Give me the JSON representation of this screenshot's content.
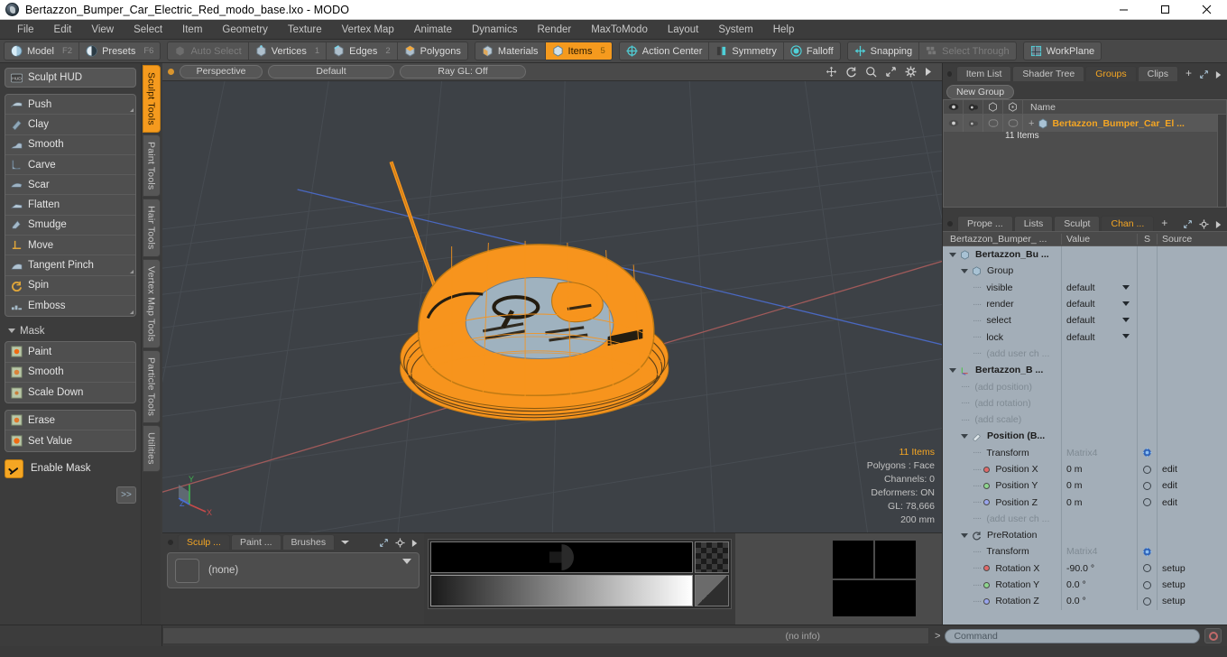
{
  "window": {
    "title": "Bertazzon_Bumper_Car_Electric_Red_modo_base.lxo - MODO",
    "app_icon": "modo-logo-icon",
    "controls": [
      {
        "name": "minimize-button",
        "glyph": "minimize-icon"
      },
      {
        "name": "maximize-button",
        "glyph": "maximize-icon"
      },
      {
        "name": "close-button",
        "glyph": "close-icon"
      }
    ]
  },
  "menubar": {
    "items": [
      "File",
      "Edit",
      "View",
      "Select",
      "Item",
      "Geometry",
      "Texture",
      "Vertex Map",
      "Animate",
      "Dynamics",
      "Render",
      "MaxToModo",
      "Layout",
      "System",
      "Help"
    ]
  },
  "toolbar": {
    "groups": [
      {
        "name": "mode-group",
        "buttons": [
          {
            "label": "Model",
            "key": "F2",
            "icon": "sphere-icon",
            "active": false,
            "dim": false
          },
          {
            "label": "Presets",
            "key": "F6",
            "icon": "half-sphere-icon",
            "active": false,
            "dim": false
          }
        ]
      },
      {
        "name": "selection-mode-group",
        "buttons": [
          {
            "label": "Auto Select",
            "key": "",
            "icon": "cube-gray-icon",
            "active": false,
            "dim": true
          },
          {
            "label": "Vertices",
            "key": "1",
            "icon": "cube-vertex-icon",
            "active": false,
            "dim": false
          },
          {
            "label": "Edges",
            "key": "2",
            "icon": "cube-edge-icon",
            "active": false,
            "dim": false
          },
          {
            "label": "Polygons",
            "key": "",
            "icon": "cube-polygon-icon",
            "active": false,
            "dim": false
          }
        ]
      },
      {
        "name": "item-mode-group",
        "buttons": [
          {
            "label": "Materials",
            "key": "",
            "icon": "cube-material-icon",
            "active": false,
            "dim": false
          },
          {
            "label": "Items",
            "key": "5",
            "icon": "cube-items-icon",
            "active": true,
            "dim": false
          }
        ]
      },
      {
        "name": "action-group",
        "buttons": [
          {
            "label": "Action Center",
            "key": "",
            "icon": "crosshair-circle-icon",
            "active": false,
            "dim": false
          },
          {
            "label": "Symmetry",
            "key": "",
            "icon": "symmetry-icon",
            "active": false,
            "dim": false
          },
          {
            "label": "Falloff",
            "key": "",
            "icon": "falloff-circle-icon",
            "active": false,
            "dim": false
          }
        ]
      },
      {
        "name": "snapping-group",
        "buttons": [
          {
            "label": "Snapping",
            "key": "",
            "icon": "snap-cross-icon",
            "active": false,
            "dim": false
          },
          {
            "label": "Select Through",
            "key": "",
            "icon": "select-through-icon",
            "active": false,
            "dim": true
          }
        ]
      },
      {
        "name": "workplane-group",
        "buttons": [
          {
            "label": "WorkPlane",
            "key": "",
            "icon": "workplane-grid-icon",
            "active": false,
            "dim": false
          }
        ]
      }
    ]
  },
  "left_panel": {
    "hud": {
      "label": "Sculpt HUD",
      "icon": "hud-icon"
    },
    "tools": [
      {
        "label": "Push",
        "icon": "push-brush-icon",
        "corner": true
      },
      {
        "label": "Clay",
        "icon": "clay-brush-icon",
        "corner": false
      },
      {
        "label": "Smooth",
        "icon": "smooth-brush-icon",
        "corner": false
      },
      {
        "label": "Carve",
        "icon": "carve-brush-icon",
        "corner": false
      },
      {
        "label": "Scar",
        "icon": "scar-brush-icon",
        "corner": false
      },
      {
        "label": "Flatten",
        "icon": "flatten-brush-icon",
        "corner": false
      },
      {
        "label": "Smudge",
        "icon": "smudge-brush-icon",
        "corner": false
      },
      {
        "label": "Move",
        "icon": "move-brush-icon",
        "corner": false
      },
      {
        "label": "Tangent Pinch",
        "icon": "pinch-brush-icon",
        "corner": true
      },
      {
        "label": "Spin",
        "icon": "spin-brush-icon",
        "corner": false
      },
      {
        "label": "Emboss",
        "icon": "emboss-brush-icon",
        "corner": true
      }
    ],
    "mask_section": {
      "header": "Mask",
      "tools": [
        {
          "label": "Paint",
          "icon": "mask-paint-icon"
        },
        {
          "label": "Smooth",
          "icon": "mask-smooth-icon"
        },
        {
          "label": "Scale Down",
          "icon": "mask-scale-icon"
        }
      ],
      "tools2": [
        {
          "label": "Erase",
          "icon": "mask-erase-icon"
        },
        {
          "label": "Set Value",
          "icon": "mask-setvalue-icon"
        }
      ],
      "enable_mask": {
        "label": "Enable Mask",
        "checked": true
      },
      "expand_label": ">>"
    },
    "vertical_tabs": [
      {
        "label": "Sculpt Tools",
        "active": true
      },
      {
        "label": "Paint Tools",
        "active": false
      },
      {
        "label": "Hair Tools",
        "active": false
      },
      {
        "label": "Vertex Map Tools",
        "active": false
      },
      {
        "label": "Particle Tools",
        "active": false
      },
      {
        "label": "Utilities",
        "active": false
      }
    ]
  },
  "viewport": {
    "header": {
      "projection": "Perspective",
      "shading": "Default",
      "raygl": "Ray GL: Off",
      "icons": [
        "pan-icon",
        "rotate-icon",
        "zoom-icon",
        "fit-icon",
        "gear-icon",
        "play-arrow-icon"
      ]
    },
    "info": {
      "items": "11 Items",
      "polygons": "Polygons : Face",
      "channels": "Channels: 0",
      "deformers": "Deformers: ON",
      "gl": "GL: 78,666",
      "scale": "200 mm"
    },
    "axis_gizmo": {
      "x": "X",
      "y": "Y",
      "z": "Z"
    },
    "colors": {
      "background": "#3d4146",
      "grid": "#4a4f55",
      "wireframe": "#f7941d",
      "surface": "#9fb2bf",
      "axis_x": "#b05555",
      "axis_z": "#4a6fc0"
    }
  },
  "bottom_panel": {
    "tabs": [
      {
        "label": "Sculp ...",
        "active": true
      },
      {
        "label": "Paint ...",
        "active": false
      },
      {
        "label": "Brushes",
        "active": false
      }
    ],
    "dropdown_icon": "chevron-down-icon",
    "tool_icons": [
      "expand-icon",
      "gear-icon",
      "play-arrow-icon"
    ],
    "preset": {
      "label": "(none)",
      "thumb": "empty-thumb"
    }
  },
  "right_panel": {
    "top_tabs": [
      {
        "label": "Item List",
        "active": false
      },
      {
        "label": "Shader Tree",
        "active": false
      },
      {
        "label": "Groups",
        "active": true
      },
      {
        "label": "Clips",
        "active": false
      }
    ],
    "top_plus": "+",
    "top_tool_icons": [
      "expand-icon",
      "play-arrow-icon"
    ],
    "new_group_button": "New Group",
    "group_table": {
      "columns": [
        "eye-icon",
        "render-icon",
        "select-icon",
        "lock-icon",
        "Name"
      ],
      "rows": [
        {
          "name": "Bertazzon_Bumper_Car_El ...",
          "sub": "11 Items",
          "icon": "group-cube-icon"
        }
      ]
    },
    "bottom_tabs": [
      {
        "label": "Prope ...",
        "active": false
      },
      {
        "label": "Lists",
        "active": false
      },
      {
        "label": "Sculpt",
        "active": false
      },
      {
        "label": "Chan ...",
        "active": true
      }
    ],
    "bottom_plus": "+",
    "bottom_tool_icons": [
      "expand-icon",
      "gear-icon",
      "play-arrow-icon"
    ],
    "channel_table": {
      "columns": [
        "Bertazzon_Bumper_ ...",
        "Value",
        "S",
        "Source"
      ],
      "rows": [
        {
          "indent": 0,
          "tree": "open",
          "icon": "cube-icon",
          "name": "Bertazzon_Bu  ...",
          "value": "",
          "s": "",
          "source": "",
          "bold": true
        },
        {
          "indent": 1,
          "tree": "open",
          "icon": "cube-icon",
          "name": "Group",
          "value": "",
          "s": "",
          "source": "",
          "bold": false
        },
        {
          "indent": 2,
          "tree": "leaf",
          "icon": "",
          "name": "visible",
          "value": "default",
          "dropdown": true,
          "s": "",
          "source": "",
          "bold": false
        },
        {
          "indent": 2,
          "tree": "leaf",
          "icon": "",
          "name": "render",
          "value": "default",
          "dropdown": true,
          "s": "",
          "source": "",
          "bold": false
        },
        {
          "indent": 2,
          "tree": "leaf",
          "icon": "",
          "name": "select",
          "value": "default",
          "dropdown": true,
          "s": "",
          "source": "",
          "bold": false
        },
        {
          "indent": 2,
          "tree": "leaf",
          "icon": "",
          "name": "lock",
          "value": "default",
          "dropdown": true,
          "s": "",
          "source": "",
          "bold": false
        },
        {
          "indent": 2,
          "tree": "leaf",
          "icon": "",
          "name": "(add user ch ...",
          "value": "",
          "s": "",
          "source": "",
          "muted": true
        },
        {
          "indent": 0,
          "tree": "open",
          "icon": "axis-icon",
          "name": "Bertazzon_B ...",
          "value": "",
          "s": "",
          "source": "",
          "bold": true
        },
        {
          "indent": 1,
          "tree": "leaf",
          "icon": "",
          "name": "(add position)",
          "value": "",
          "s": "",
          "source": "",
          "muted": true
        },
        {
          "indent": 1,
          "tree": "leaf",
          "icon": "",
          "name": "(add rotation)",
          "value": "",
          "s": "",
          "source": "",
          "muted": true
        },
        {
          "indent": 1,
          "tree": "leaf",
          "icon": "",
          "name": "(add scale)",
          "value": "",
          "s": "",
          "source": "",
          "muted": true
        },
        {
          "indent": 1,
          "tree": "open",
          "icon": "position-icon",
          "name": "Position (B...",
          "value": "",
          "s": "",
          "source": "",
          "bold": true
        },
        {
          "indent": 2,
          "tree": "leaf",
          "icon": "",
          "name": "Transform",
          "value": "Matrix4",
          "valueMuted": true,
          "s": "gear",
          "source": "",
          "bold": false
        },
        {
          "indent": 2,
          "tree": "leaf",
          "icon": "dot-red",
          "name": "Position X",
          "value": "0 m",
          "s": "ring",
          "source": "edit",
          "bold": false
        },
        {
          "indent": 2,
          "tree": "leaf",
          "icon": "dot-green",
          "name": "Position Y",
          "value": "0 m",
          "s": "ring",
          "source": "edit",
          "bold": false
        },
        {
          "indent": 2,
          "tree": "leaf",
          "icon": "dot-blue",
          "name": "Position Z",
          "value": "0 m",
          "s": "ring",
          "source": "edit",
          "bold": false
        },
        {
          "indent": 2,
          "tree": "leaf",
          "icon": "",
          "name": "(add user ch ...",
          "value": "",
          "s": "",
          "source": "",
          "muted": true
        },
        {
          "indent": 1,
          "tree": "open",
          "icon": "rotation-icon",
          "name": "PreRotation",
          "value": "",
          "s": "",
          "source": "",
          "bold": false
        },
        {
          "indent": 2,
          "tree": "leaf",
          "icon": "",
          "name": "Transform",
          "value": "Matrix4",
          "valueMuted": true,
          "s": "gear",
          "source": "",
          "bold": false
        },
        {
          "indent": 2,
          "tree": "leaf",
          "icon": "dot-red",
          "name": "Rotation X",
          "value": "-90.0 °",
          "s": "ring",
          "source": "setup",
          "bold": false
        },
        {
          "indent": 2,
          "tree": "leaf",
          "icon": "dot-green",
          "name": "Rotation Y",
          "value": "0.0 °",
          "s": "ring",
          "source": "setup",
          "bold": false
        },
        {
          "indent": 2,
          "tree": "leaf",
          "icon": "dot-blue",
          "name": "Rotation Z",
          "value": "0.0 °",
          "s": "ring",
          "source": "setup",
          "bold": false
        }
      ]
    }
  },
  "statusbar": {
    "info": "(no info)",
    "command_prompt": ">",
    "command_placeholder": "Command",
    "record_icon": "record-circle-icon"
  },
  "colors": {
    "accent": "#f5a623",
    "panel_bg": "#3c3c3c",
    "toolbar_bg": "#484848",
    "channel_bg": "#a3aeb8",
    "viewport_bg": "#3d4146"
  }
}
